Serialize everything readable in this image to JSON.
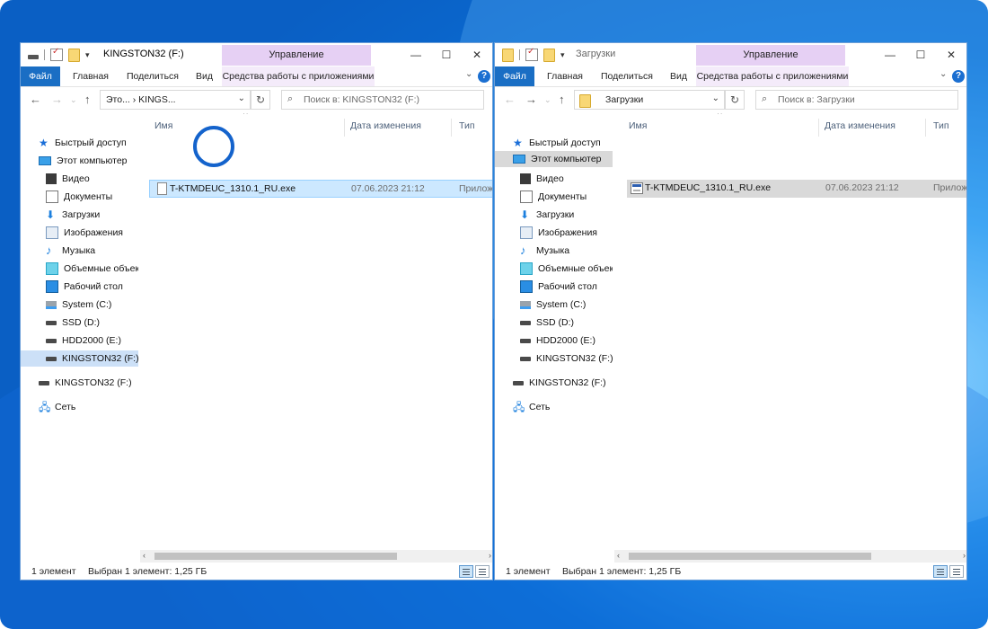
{
  "windows": [
    {
      "title": "KINGSTON32 (F:)",
      "ribbon": {
        "upravlenie": "Управление",
        "tabs": [
          "Файл",
          "Главная",
          "Поделиться",
          "Вид"
        ],
        "app_tools": "Средства работы с приложениями"
      },
      "address": "Это...  ›  KINGS...",
      "search_placeholder": "Поиск в: KINGSTON32 (F:)",
      "columns": [
        "Имя",
        "Дата изменения",
        "Тип"
      ],
      "nav": {
        "quick": "Быстрый доступ",
        "pc": "Этот компьютер",
        "items": [
          "Видео",
          "Документы",
          "Загрузки",
          "Изображения",
          "Музыка",
          "Объемные объекты",
          "Рабочий стол",
          "System (C:)",
          "SSD (D:)",
          "HDD2000 (E:)",
          "KINGSTON32 (F:)"
        ],
        "usb": "KINGSTON32 (F:)",
        "network": "Сеть"
      },
      "file": {
        "name": "T-KTMDEUC_1310.1_RU.exe",
        "date": "07.06.2023 21:12",
        "type": "Прилож"
      },
      "status": {
        "count": "1 элемент",
        "selected": "Выбран 1 элемент: 1,25 ГБ"
      }
    },
    {
      "title": "Загрузки",
      "ribbon": {
        "upravlenie": "Управление",
        "tabs": [
          "Файл",
          "Главная",
          "Поделиться",
          "Вид"
        ],
        "app_tools": "Средства работы с приложениями"
      },
      "address": "Загрузки",
      "search_placeholder": "Поиск в: Загрузки",
      "columns": [
        "Имя",
        "Дата изменения",
        "Тип"
      ],
      "nav": {
        "quick": "Быстрый доступ",
        "pc": "Этот компьютер",
        "items": [
          "Видео",
          "Документы",
          "Загрузки",
          "Изображения",
          "Музыка",
          "Объемные объекты",
          "Рабочий стол",
          "System (C:)",
          "SSD (D:)",
          "HDD2000 (E:)",
          "KINGSTON32 (F:)"
        ],
        "usb": "KINGSTON32 (F:)",
        "network": "Сеть"
      },
      "file": {
        "name": "T-KTMDEUC_1310.1_RU.exe",
        "date": "07.06.2023 21:12",
        "type": "Прилож"
      },
      "status": {
        "count": "1 элемент",
        "selected": "Выбран 1 элемент: 1,25 ГБ"
      }
    }
  ],
  "icons": {
    "window_controls": [
      "minimize-icon",
      "maximize-icon",
      "close-icon"
    ],
    "nav_buttons": [
      "back-arrow-icon",
      "forward-arrow-icon",
      "up-arrow-icon"
    ]
  },
  "colors": {
    "file_tab": "#1a6ec4",
    "manage_tab": "#e6d0f4",
    "selection_highlight": "#cce8ff",
    "nav_selection": "#cce0f7",
    "annotation_circle": "#1463cc"
  }
}
